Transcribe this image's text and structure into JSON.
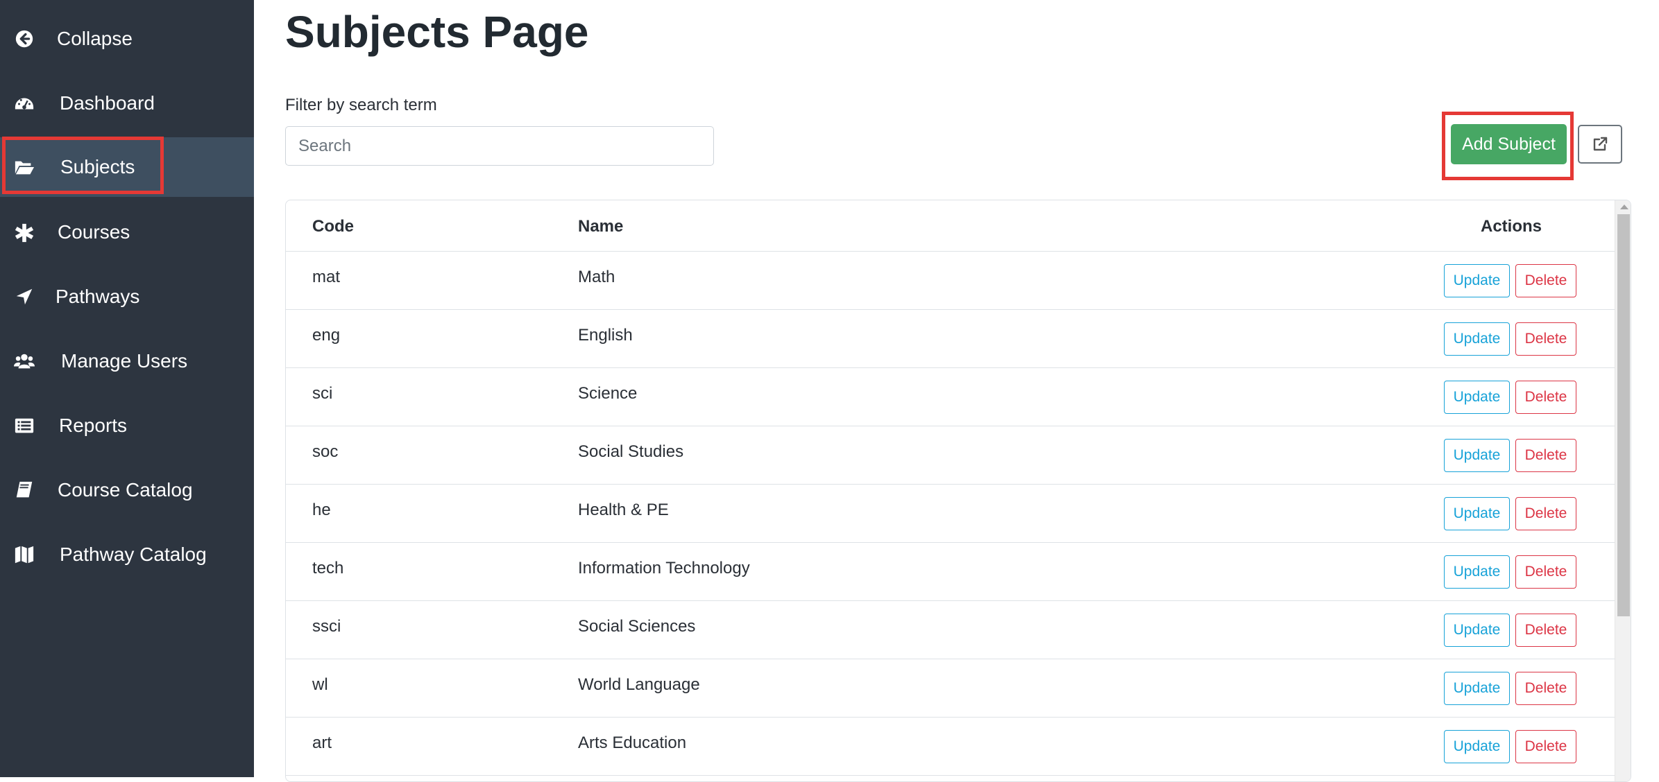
{
  "sidebar": {
    "items": [
      {
        "label": "Collapse",
        "icon": "arrow-circle-left-icon"
      },
      {
        "label": "Dashboard",
        "icon": "dashboard-gauge-icon"
      },
      {
        "label": "Subjects",
        "icon": "folder-open-icon",
        "active": true
      },
      {
        "label": "Courses",
        "icon": "asterisk-icon"
      },
      {
        "label": "Pathways",
        "icon": "location-arrow-icon"
      },
      {
        "label": "Manage Users",
        "icon": "users-icon"
      },
      {
        "label": "Reports",
        "icon": "list-alt-icon"
      },
      {
        "label": "Course Catalog",
        "icon": "book-icon"
      },
      {
        "label": "Pathway Catalog",
        "icon": "map-icon"
      }
    ]
  },
  "main": {
    "title": "Subjects Page",
    "filter_label": "Filter by search term",
    "search_placeholder": "Search",
    "search_value": "",
    "add_button_label": "Add Subject",
    "external_link_icon": "external-link-icon"
  },
  "table": {
    "columns": {
      "code": "Code",
      "name": "Name",
      "actions": "Actions"
    },
    "update_label": "Update",
    "delete_label": "Delete",
    "rows": [
      {
        "code": "mat",
        "name": "Math"
      },
      {
        "code": "eng",
        "name": "English"
      },
      {
        "code": "sci",
        "name": "Science"
      },
      {
        "code": "soc",
        "name": "Social Studies"
      },
      {
        "code": "he",
        "name": "Health & PE"
      },
      {
        "code": "tech",
        "name": "Information Technology"
      },
      {
        "code": "ssci",
        "name": "Social Sciences"
      },
      {
        "code": "wl",
        "name": "World Language"
      },
      {
        "code": "art",
        "name": "Arts Education"
      }
    ]
  },
  "colors": {
    "sidebar_bg": "#2d3540",
    "sidebar_active": "#3e4f60",
    "highlight": "#e53935",
    "add_button": "#47a764",
    "update": "#17a2d8",
    "delete": "#dc3545"
  }
}
